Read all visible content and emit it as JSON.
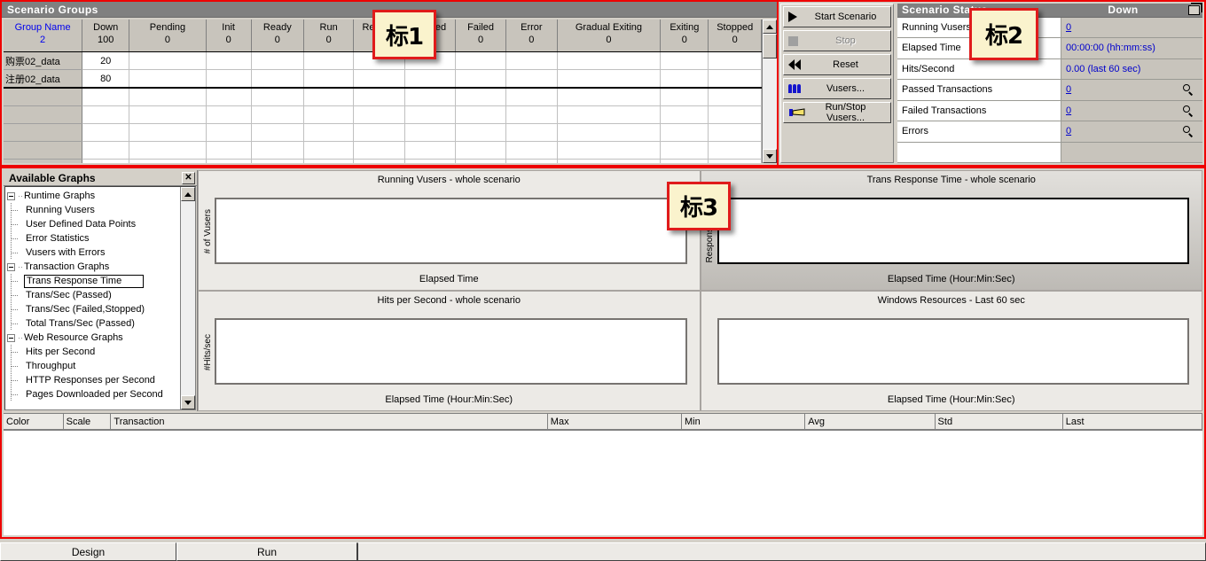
{
  "scenario_groups": {
    "title": "Scenario Groups",
    "columns": [
      {
        "name": "Group Name",
        "value": "2"
      },
      {
        "name": "Down",
        "value": "100"
      },
      {
        "name": "Pending",
        "value": "0"
      },
      {
        "name": "Init",
        "value": "0"
      },
      {
        "name": "Ready",
        "value": "0"
      },
      {
        "name": "Run",
        "value": "0"
      },
      {
        "name": "Rendez",
        "value": "0"
      },
      {
        "name": "Passed",
        "value": "0"
      },
      {
        "name": "Failed",
        "value": "0"
      },
      {
        "name": "Error",
        "value": "0"
      },
      {
        "name": "Gradual Exiting",
        "value": "0"
      },
      {
        "name": "Exiting",
        "value": "0"
      },
      {
        "name": "Stopped",
        "value": "0"
      }
    ],
    "rows": [
      {
        "group_name": "购票02_data",
        "down": "20"
      },
      {
        "group_name": "注册02_data",
        "down": "80"
      }
    ],
    "empty_row_count": 6
  },
  "controls": {
    "buttons": [
      {
        "label": "Start Scenario",
        "icon": "play-icon",
        "disabled": false
      },
      {
        "label": "Stop",
        "icon": "stop-icon",
        "disabled": true
      },
      {
        "label": "Reset",
        "icon": "rewind-icon",
        "disabled": false
      },
      {
        "label": "Vusers...",
        "icon": "vusers-icon",
        "disabled": false
      },
      {
        "label": "Run/Stop Vusers...",
        "icon": "run-stop-vusers-icon",
        "disabled": false
      }
    ]
  },
  "scenario_status": {
    "title": "Scenario Status",
    "status_value": "Down",
    "rows": [
      {
        "label": "Running Vusers",
        "value": "0",
        "link": true,
        "magnifier": false
      },
      {
        "label": "Elapsed Time",
        "value": "00:00:00 (hh:mm:ss)",
        "link": false,
        "magnifier": false
      },
      {
        "label": "Hits/Second",
        "value": "0.00 (last 60 sec)",
        "link": false,
        "magnifier": false
      },
      {
        "label": "Passed Transactions",
        "value": "0",
        "link": true,
        "magnifier": true
      },
      {
        "label": "Failed Transactions",
        "value": "0",
        "link": true,
        "magnifier": true
      },
      {
        "label": "Errors",
        "value": "0",
        "link": true,
        "magnifier": true
      }
    ]
  },
  "available_graphs": {
    "title": "Available Graphs",
    "close_label": "✕",
    "tree": [
      {
        "label": "Runtime Graphs",
        "type": "group"
      },
      {
        "label": "Running Vusers",
        "type": "leaf"
      },
      {
        "label": "User Defined Data Points",
        "type": "leaf"
      },
      {
        "label": "Error Statistics",
        "type": "leaf"
      },
      {
        "label": "Vusers with Errors",
        "type": "leaf"
      },
      {
        "label": "Transaction Graphs",
        "type": "group"
      },
      {
        "label": "Trans Response Time",
        "type": "leaf",
        "selected": true
      },
      {
        "label": "Trans/Sec (Passed)",
        "type": "leaf"
      },
      {
        "label": "Trans/Sec (Failed,Stopped)",
        "type": "leaf"
      },
      {
        "label": "Total Trans/Sec (Passed)",
        "type": "leaf"
      },
      {
        "label": "Web Resource Graphs",
        "type": "group"
      },
      {
        "label": "Hits per Second",
        "type": "leaf"
      },
      {
        "label": "Throughput",
        "type": "leaf"
      },
      {
        "label": "HTTP Responses per Second",
        "type": "leaf"
      },
      {
        "label": "Pages Downloaded per Second",
        "type": "leaf"
      }
    ]
  },
  "chart_data": [
    {
      "type": "line",
      "title": "Running Vusers - whole scenario",
      "ylabel": "# of Vusers",
      "xlabel": "Elapsed Time",
      "series": [],
      "x": [],
      "selected": false,
      "grid": false
    },
    {
      "type": "line",
      "title": "Trans Response Time - whole scenario",
      "ylabel": "Response Time",
      "xlabel": "Elapsed Time (Hour:Min:Sec)",
      "series": [],
      "x": [],
      "selected": true,
      "grid": false
    },
    {
      "type": "line",
      "title": "Hits per Second - whole scenario",
      "ylabel": "#Hits/sec",
      "xlabel": "Elapsed Time (Hour:Min:Sec)",
      "series": [],
      "x": [],
      "selected": false,
      "grid": false
    },
    {
      "type": "line",
      "title": "Windows Resources - Last 60 sec",
      "ylabel": "",
      "xlabel": "Elapsed Time (Hour:Min:Sec)",
      "series": [],
      "x": [],
      "selected": false,
      "grid": false
    }
  ],
  "legend": {
    "columns": [
      "Color",
      "Scale",
      "Transaction",
      "Max",
      "Min",
      "Avg",
      "Std",
      "Last"
    ],
    "rows": []
  },
  "tabs": [
    {
      "label": "Design",
      "active": false
    },
    {
      "label": "Run",
      "active": true
    },
    {
      "label": "",
      "active": false
    }
  ],
  "annotations": [
    {
      "id": "callout-1",
      "text": "标1"
    },
    {
      "id": "callout-2",
      "text": "标2"
    },
    {
      "id": "callout-3",
      "text": "标3"
    }
  ]
}
